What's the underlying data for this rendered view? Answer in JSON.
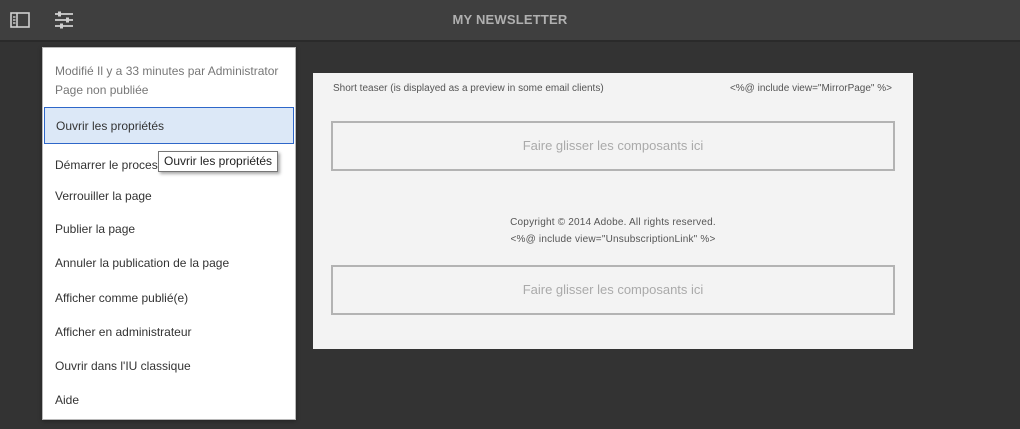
{
  "topbar": {
    "title": "MY NEWSLETTER",
    "icons": {
      "left": "sidebar-toggle-icon",
      "right": "page-properties-icon"
    }
  },
  "page_menu": {
    "modified_line": "Modifié Il y a 33 minutes par Administrator",
    "status_line": "Page non publiée",
    "items": [
      {
        "label": "Ouvrir les propriétés",
        "active": true
      },
      {
        "label": "Démarrer le proces"
      },
      {
        "label": "Verrouiller la page"
      },
      {
        "label": "Publier la page"
      },
      {
        "label": "Annuler la publication de la page"
      },
      {
        "label": "Afficher comme publié(e)"
      },
      {
        "label": "Afficher en administrateur"
      },
      {
        "label": "Ouvrir dans l'IU classique"
      },
      {
        "label": "Aide"
      }
    ],
    "tooltip": "Ouvrir les propriétés"
  },
  "newsletter": {
    "teaser": "Short teaser (is displayed as a preview in some email clients)",
    "mirror_include": "<%@ include view=\"MirrorPage\" %>",
    "dropzone_1": "Faire glisser les composants ici",
    "copyright": "Copyright © 2014 Adobe. All rights reserved.",
    "unsubscribe_include": "<%@ include view=\"UnsubscriptionLink\" %>",
    "dropzone_2": "Faire glisser les composants ici"
  },
  "colors": {
    "background": "#333333",
    "topbar": "#3f3f3f",
    "active_item_bg": "#dce8f7",
    "active_item_border": "#2e67c9"
  }
}
